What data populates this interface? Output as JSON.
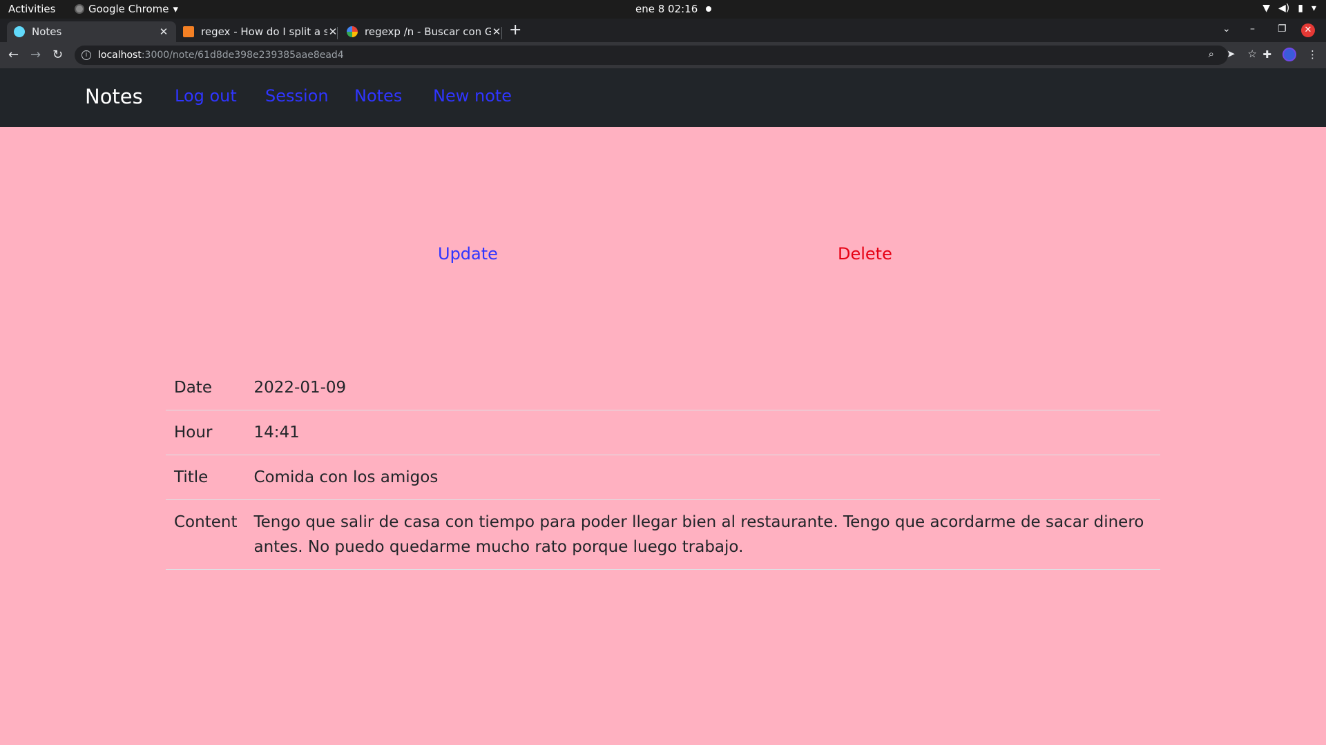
{
  "system_bar": {
    "activities": "Activities",
    "app_name": "Google Chrome",
    "clock": "ene 8  02:16"
  },
  "browser": {
    "tabs": [
      {
        "title": "Notes",
        "favicon": "react-icon",
        "active": true
      },
      {
        "title": "regex - How do I split a str",
        "favicon": "stackoverflow-icon",
        "active": false
      },
      {
        "title": "regexp /n - Buscar con Go",
        "favicon": "google-icon",
        "active": false
      }
    ],
    "url_host": "localhost",
    "url_path": ":3000/note/61d8de398e239385aae8ead4"
  },
  "navbar": {
    "brand": "Notes",
    "links": [
      "Log out",
      "Session",
      "Notes",
      "New note"
    ]
  },
  "actions": {
    "update": "Update",
    "delete": "Delete"
  },
  "note": {
    "rows": [
      {
        "label": "Date",
        "value": "2022-01-09"
      },
      {
        "label": "Hour",
        "value": "14:41"
      },
      {
        "label": "Title",
        "value": "Comida con los amigos"
      },
      {
        "label": "Content",
        "value": "Tengo que salir de casa con tiempo para poder llegar bien al restaurante. Tengo que acordarme de sacar dinero antes. No puedo quedarme mucho rato porque luego trabajo."
      }
    ]
  },
  "colors": {
    "page_bg": "#ffb1c1",
    "navbar_bg": "#212529",
    "link": "#2f35ff",
    "danger": "#e60012"
  }
}
